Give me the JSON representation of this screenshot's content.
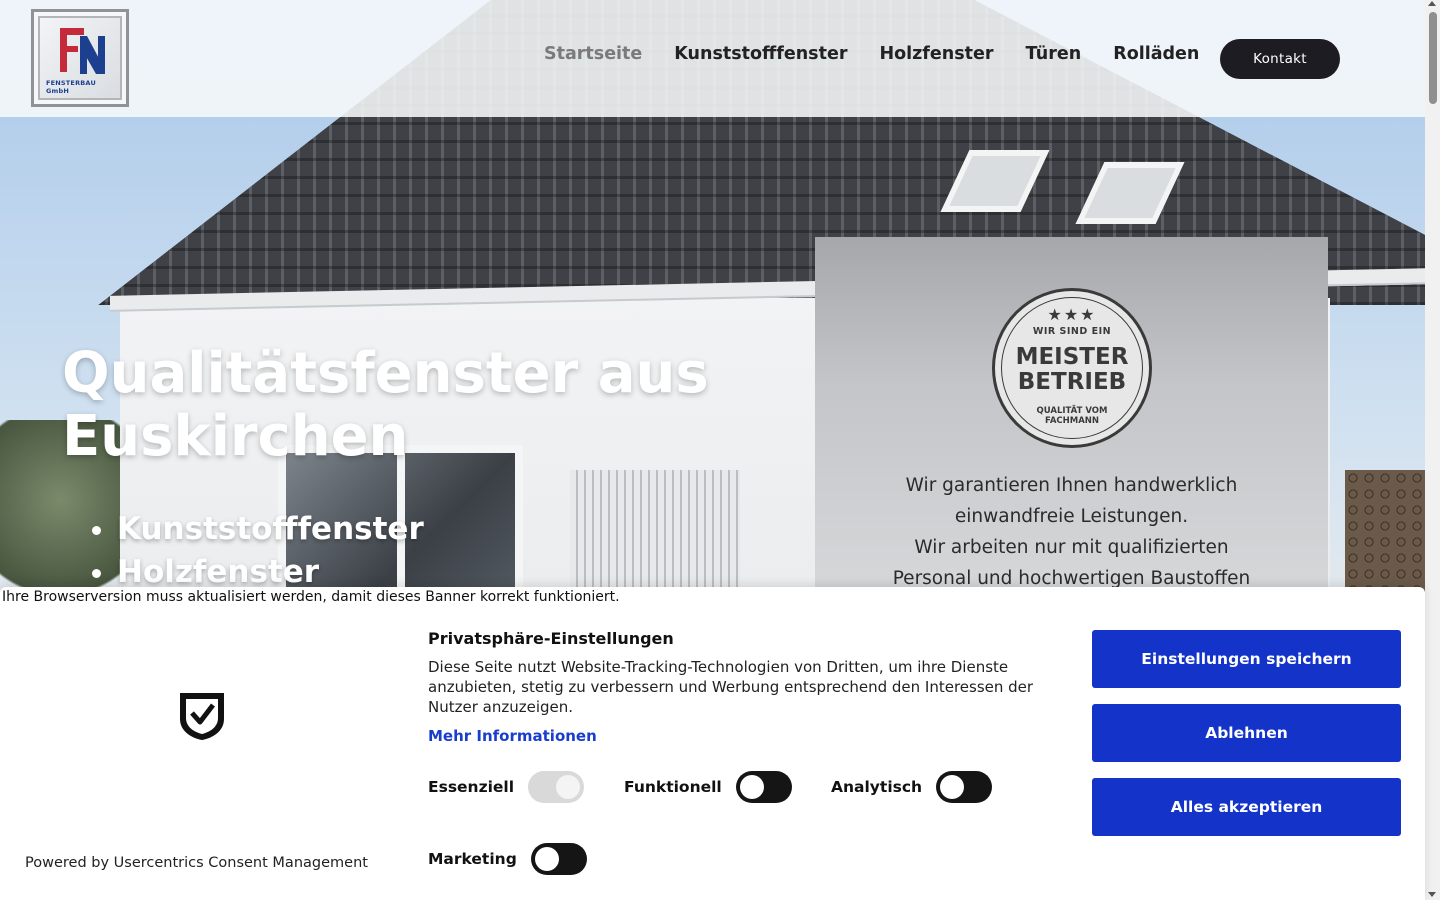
{
  "header": {
    "logo_text": "FENSTERBAU GmbH",
    "nav": [
      {
        "label": "Startseite",
        "active": true
      },
      {
        "label": "Kunststofffenster",
        "active": false
      },
      {
        "label": "Holzfenster",
        "active": false
      },
      {
        "label": "Türen",
        "active": false
      },
      {
        "label": "Rolläden",
        "active": false
      }
    ],
    "contact_label": "Kontakt"
  },
  "hero": {
    "title_line1": "Qualitätsfenster aus",
    "title_line2": "Euskirchen",
    "list": [
      "Kunststofffenster",
      "Holzfenster"
    ]
  },
  "card": {
    "seal_stars": "★★★",
    "seal_top": "WIR SIND EIN",
    "seal_main_1": "MEISTER",
    "seal_main_2": "BETRIEB",
    "seal_bottom_1": "QUALITÄT VOM",
    "seal_bottom_2": "FACHMANN",
    "text_line1": "Wir garantieren Ihnen handwerklich",
    "text_line2": "einwandfreie Leistungen.",
    "text_line3": "Wir arbeiten nur mit qualifizierten",
    "text_line4": "Personal und hochwertigen Baustoffen"
  },
  "consent": {
    "browser_warning": "Ihre Browserversion muss aktualisiert werden, damit dieses Banner korrekt funktioniert.",
    "title": "Privatsphäre-Einstellungen",
    "description": "Diese Seite nutzt Website-Tracking-Technologien von Dritten, um ihre Dienste anzubieten, stetig zu verbessern und Werbung entsprechend den Interessen der Nutzer anzuzeigen.",
    "more_info": "Mehr Informationen",
    "toggles": {
      "essenziell": "Essenziell",
      "funktionell": "Funktionell",
      "analytisch": "Analytisch",
      "marketing": "Marketing"
    },
    "buttons": {
      "save": "Einstellungen speichern",
      "decline": "Ablehnen",
      "accept_all": "Alles akzeptieren"
    },
    "powered_by": "Powered by Usercentrics Consent Management"
  },
  "colors": {
    "primary_button": "#1333c9",
    "contact_button": "#1c1c22",
    "link": "#1a3ecc"
  }
}
